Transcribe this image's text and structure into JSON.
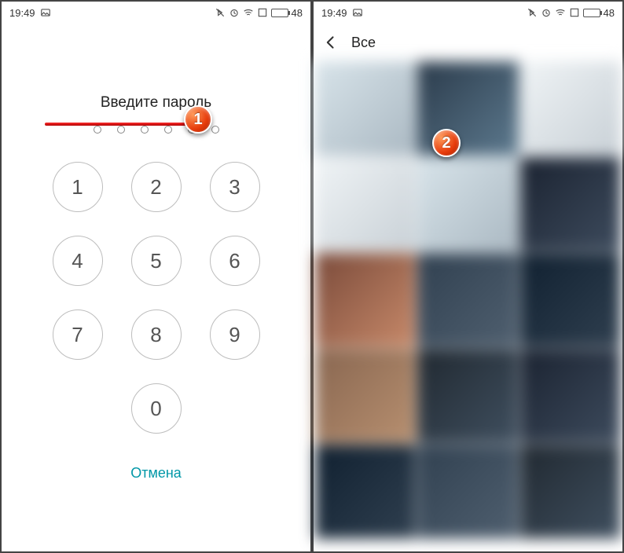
{
  "status_bar": {
    "time": "19:49",
    "battery_pct": "48"
  },
  "lock_screen": {
    "prompt": "Введите пароль",
    "keys": [
      "1",
      "2",
      "3",
      "4",
      "5",
      "6",
      "7",
      "8",
      "9",
      "0"
    ],
    "cancel_label": "Отмена",
    "pin_length": 6
  },
  "gallery": {
    "title": "Все"
  },
  "callouts": {
    "one": "1",
    "two": "2"
  }
}
